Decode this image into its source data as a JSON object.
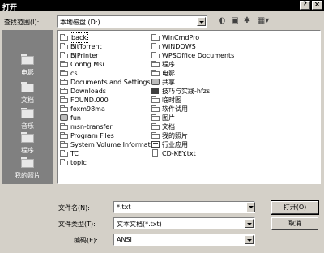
{
  "window": {
    "title": "打开",
    "help_glyph": "?",
    "close_glyph": "×"
  },
  "lookin": {
    "label": "查找范围(I):",
    "value": "本地磁盘 (D:)"
  },
  "places": [
    {
      "label": "电影",
      "icon": "folder-icon"
    },
    {
      "label": "文档",
      "icon": "folder-icon"
    },
    {
      "label": "音乐",
      "icon": "folder-icon"
    },
    {
      "label": "程序",
      "icon": "folder-icon"
    },
    {
      "label": "我的照片",
      "icon": "folder-icon"
    }
  ],
  "files": {
    "col1": [
      {
        "name": "back",
        "icon": "folder",
        "selected": true
      },
      {
        "name": "BitTorrent",
        "icon": "folder"
      },
      {
        "name": "BJPrinter",
        "icon": "folder"
      },
      {
        "name": "Config.Msi",
        "icon": "folder"
      },
      {
        "name": "cs",
        "icon": "folder"
      },
      {
        "name": "Documents and Settings",
        "icon": "folder"
      },
      {
        "name": "Downloads",
        "icon": "folder"
      },
      {
        "name": "FOUND.000",
        "icon": "folder"
      },
      {
        "name": "foxm98ma",
        "icon": "folder"
      },
      {
        "name": "fun",
        "icon": "share"
      },
      {
        "name": "msn-transfer",
        "icon": "folder"
      },
      {
        "name": "Program Files",
        "icon": "folder"
      },
      {
        "name": "System Volume Information",
        "icon": "folder"
      },
      {
        "name": "TC",
        "icon": "folder"
      },
      {
        "name": "topic",
        "icon": "folder"
      }
    ],
    "col2": [
      {
        "name": "WinCmdPro",
        "icon": "folder"
      },
      {
        "name": "WINDOWS",
        "icon": "folder"
      },
      {
        "name": "WPSOffice Documents",
        "icon": "folder"
      },
      {
        "name": "程序",
        "icon": "folder"
      },
      {
        "name": "电影",
        "icon": "folder"
      },
      {
        "name": "共享",
        "icon": "share"
      },
      {
        "name": "技巧与实践-hfzs",
        "icon": "book"
      },
      {
        "name": "临时图",
        "icon": "folder"
      },
      {
        "name": "软件试用",
        "icon": "folder"
      },
      {
        "name": "图片",
        "icon": "folder"
      },
      {
        "name": "文档",
        "icon": "folder"
      },
      {
        "name": "我的照片",
        "icon": "folder"
      },
      {
        "name": "行业应用",
        "icon": "app"
      },
      {
        "name": "CD-KEY.txt",
        "icon": "doc"
      }
    ]
  },
  "filename": {
    "label": "文件名(N):",
    "value": "*.txt"
  },
  "filetype": {
    "label": "文件类型(T):",
    "value": "文本文档(*.txt)"
  },
  "encoding": {
    "label": "编码(E):",
    "value": "ANSI"
  },
  "buttons": {
    "open": "打开(O)",
    "cancel": "取消"
  }
}
